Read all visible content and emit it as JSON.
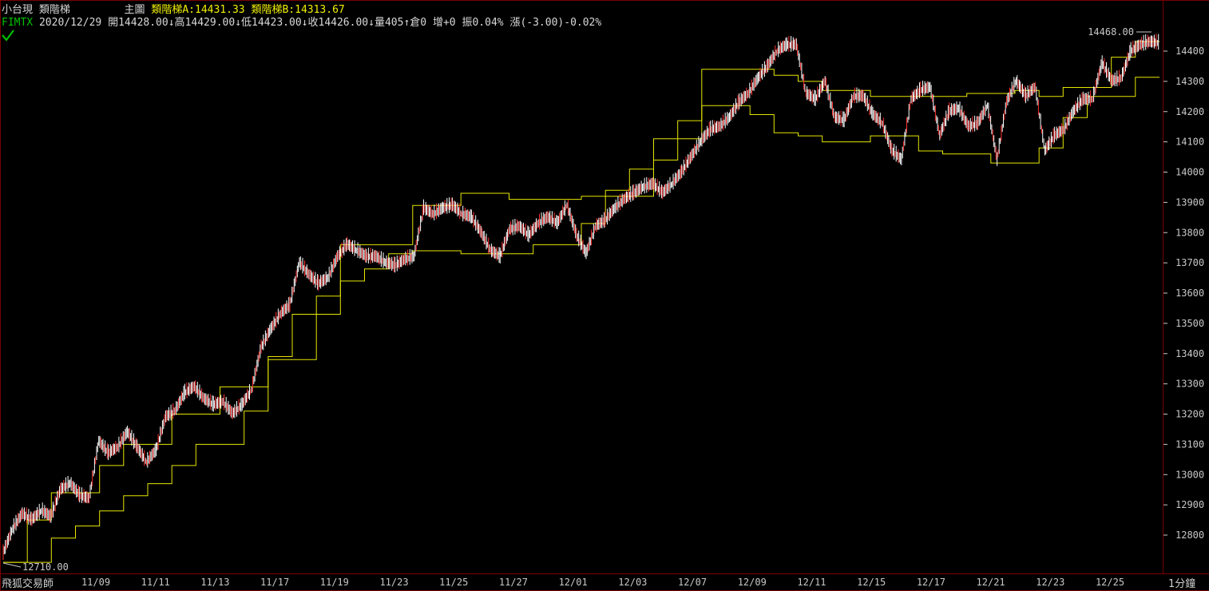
{
  "header": {
    "product": "小台現",
    "indicator": "類階梯",
    "pane": "主圖",
    "ladder_a_label": "類階梯A:",
    "ladder_a_value": "14431.33",
    "ladder_b_label": "類階梯B:",
    "ladder_b_value": "14313.67",
    "symbol": "FIMTX",
    "date": "2020/12/29",
    "open_label": "開",
    "open": "14428.00",
    "high_label": "高",
    "high": "14429.00",
    "low_label": "低",
    "low": "14423.00",
    "close_label": "收",
    "close": "14426.00",
    "volume_label": "量",
    "volume": "405",
    "oi_label": "倉",
    "oi": "0",
    "oi_change_label": "增",
    "oi_change": "+0",
    "amplitude_label": "振",
    "amplitude": "0.04%",
    "change_label": "漲",
    "change": "(-3.00)-0.02%",
    "down_arrow": "↓",
    "up_arrow": "↑",
    "check_icon": "checkmark-icon"
  },
  "footer": {
    "app_name": "飛狐交易師",
    "interval": "1分鐘"
  },
  "colors": {
    "background": "#000000",
    "frame": "#7a0000",
    "ladder": "#e6e600",
    "bar_up": "#ff3030",
    "bar_down": "#ffffff",
    "text": "#c8c8c8",
    "symbol": "#00c000"
  },
  "chart_data": {
    "type": "line",
    "title": "",
    "xlabel": "",
    "ylabel": "",
    "x_tick_labels": [
      "11/09",
      "11/11",
      "11/13",
      "11/17",
      "11/19",
      "11/23",
      "11/25",
      "11/27",
      "12/01",
      "12/03",
      "12/07",
      "12/09",
      "12/11",
      "12/15",
      "12/17",
      "12/21",
      "12/23",
      "12/25"
    ],
    "y_tick_labels": [
      "12800",
      "12900",
      "13000",
      "13100",
      "13200",
      "13300",
      "13400",
      "13500",
      "13600",
      "13700",
      "13800",
      "13900",
      "14000",
      "14100",
      "14200",
      "14300",
      "14400"
    ],
    "ylim": [
      12710,
      14468
    ],
    "highest_label": "14468.00",
    "lowest_label": "12710.00",
    "grid": false,
    "series": [
      {
        "role": "price",
        "values": [
          12740,
          12820,
          12870,
          12850,
          12880,
          12860,
          12950,
          12970,
          12930,
          12920,
          13110,
          13070,
          13090,
          13140,
          13090,
          13040,
          13080,
          13190,
          13210,
          13270,
          13290,
          13250,
          13230,
          13240,
          13200,
          13230,
          13280,
          13420,
          13480,
          13530,
          13560,
          13700,
          13660,
          13630,
          13650,
          13720,
          13760,
          13740,
          13720,
          13720,
          13700,
          13690,
          13710,
          13720,
          13880,
          13860,
          13880,
          13890,
          13860,
          13850,
          13800,
          13740,
          13720,
          13810,
          13820,
          13790,
          13830,
          13850,
          13830,
          13890,
          13790,
          13730,
          13820,
          13840,
          13880,
          13910,
          13930,
          13950,
          13960,
          13930,
          13960,
          14000,
          14050,
          14100,
          14140,
          14150,
          14180,
          14230,
          14260,
          14310,
          14350,
          14400,
          14420,
          14420,
          14260,
          14240,
          14300,
          14180,
          14170,
          14250,
          14250,
          14190,
          14160,
          14070,
          14040,
          14240,
          14270,
          14280,
          14120,
          14200,
          14210,
          14150,
          14160,
          14220,
          14040,
          14230,
          14300,
          14250,
          14280,
          14070,
          14120,
          14140,
          14200,
          14240,
          14240,
          14360,
          14300,
          14310,
          14400,
          14420,
          14430,
          14426
        ]
      },
      {
        "name": "類階梯A",
        "values": [
          12710,
          12850,
          12940,
          12940,
          13030,
          13100,
          13100,
          13200,
          13200,
          13290,
          13290,
          13390,
          13530,
          13530,
          13760,
          13760,
          13760,
          13890,
          13890,
          13930,
          13930,
          13910,
          13910,
          13910,
          13920,
          13920,
          13920,
          14110,
          14110,
          14340,
          14340,
          14340,
          14320,
          14300,
          14270,
          14270,
          14250,
          14250,
          14250,
          14250,
          14260,
          14260,
          14270,
          14250,
          14280,
          14280,
          14380,
          14431.33
        ]
      },
      {
        "name": "類階梯B",
        "values": [
          12710,
          12710,
          12790,
          12830,
          12880,
          12930,
          12970,
          13030,
          13100,
          13100,
          13210,
          13380,
          13380,
          13590,
          13640,
          13680,
          13730,
          13740,
          13740,
          13730,
          13730,
          13730,
          13760,
          13760,
          13830,
          13940,
          14010,
          14040,
          14170,
          14220,
          14220,
          14190,
          14130,
          14120,
          14100,
          14100,
          14120,
          14120,
          14070,
          14060,
          14060,
          14030,
          14030,
          14080,
          14180,
          14250,
          14250,
          14313.67
        ]
      }
    ]
  }
}
